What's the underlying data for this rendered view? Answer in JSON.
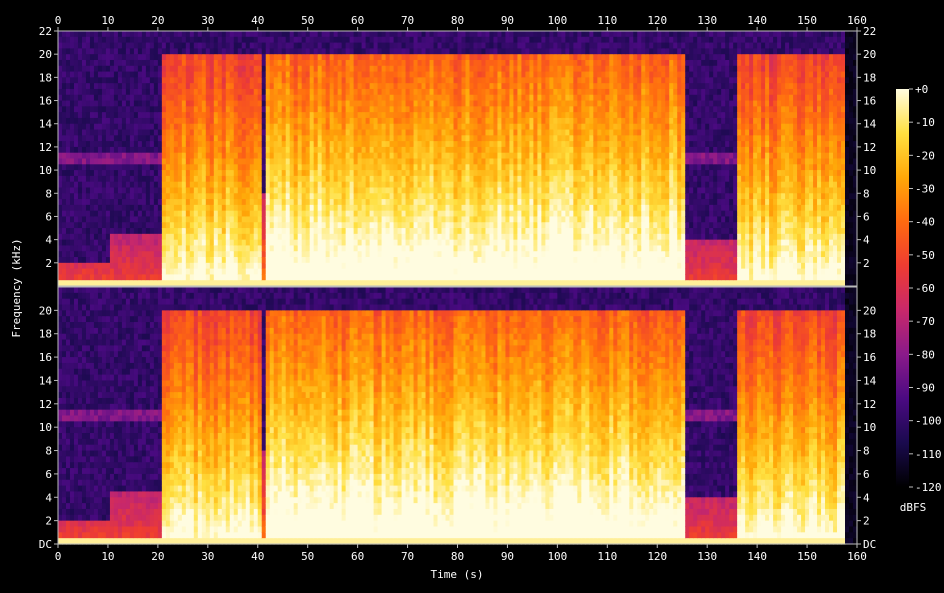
{
  "chart_data": {
    "type": "heatmap",
    "title": "",
    "xlabel": "Time (s)",
    "ylabel": "Frequency (kHz)",
    "xlim": [
      0,
      160
    ],
    "x_ticks": [
      "0",
      "10",
      "20",
      "30",
      "40",
      "50",
      "60",
      "70",
      "80",
      "90",
      "100",
      "110",
      "120",
      "130",
      "140",
      "150",
      "160"
    ],
    "ylim_khz": [
      0,
      22
    ],
    "y_ticks_top": [
      "2",
      "4",
      "6",
      "8",
      "10",
      "12",
      "14",
      "16",
      "18",
      "20",
      "22"
    ],
    "y_ticks_bottom": [
      "DC",
      "2",
      "4",
      "6",
      "8",
      "10",
      "12",
      "14",
      "16",
      "18",
      "20"
    ],
    "channels": 2,
    "colorbar": {
      "label": "dBFS",
      "range": [
        -120,
        0
      ],
      "ticks": [
        "+0",
        "-10",
        "-20",
        "-30",
        "-40",
        "-50",
        "-60",
        "-70",
        "-80",
        "-90",
        "-100",
        "-110",
        "-120"
      ],
      "colors": [
        "#000000",
        "#1a0a4e",
        "#4b0a82",
        "#8a1a8a",
        "#c8286a",
        "#ee3c32",
        "#ff6a10",
        "#ffa808",
        "#ffe040",
        "#fffce0"
      ]
    },
    "segments": [
      {
        "t_start": 0,
        "t_end": 10.5,
        "energy": "quiet",
        "top_khz": 2
      },
      {
        "t_start": 10.5,
        "t_end": 20.8,
        "energy": "quiet",
        "top_khz": 4.5
      },
      {
        "t_start": 20.8,
        "t_end": 41,
        "energy": "loud",
        "top_khz": 20
      },
      {
        "t_start": 41,
        "t_end": 42,
        "energy": "dip",
        "top_khz": 8
      },
      {
        "t_start": 42,
        "t_end": 126,
        "energy": "loudest",
        "top_khz": 20
      },
      {
        "t_start": 126,
        "t_end": 136,
        "energy": "quiet",
        "top_khz": 4
      },
      {
        "t_start": 136,
        "t_end": 157.5,
        "energy": "loud",
        "top_khz": 20
      },
      {
        "t_start": 157.5,
        "t_end": 160,
        "energy": "silent",
        "top_khz": 0
      }
    ]
  }
}
